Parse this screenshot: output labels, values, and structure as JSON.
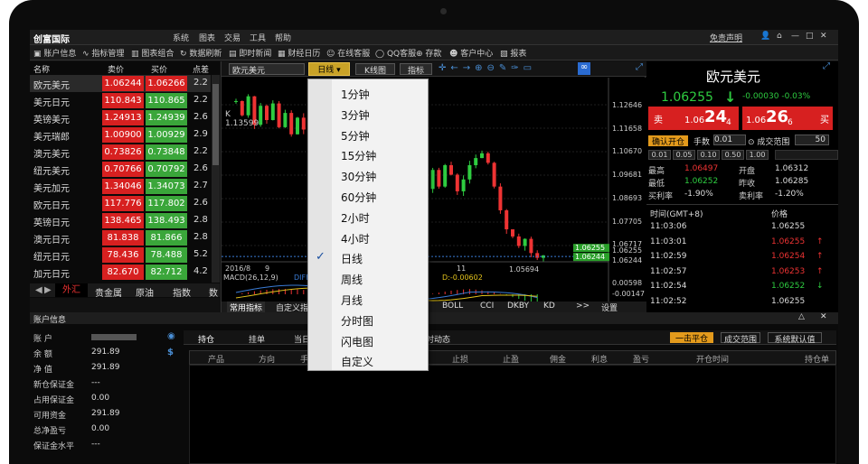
{
  "app": {
    "logo": "创富国际",
    "menus": [
      "系统",
      "图表",
      "交易",
      "工具",
      "帮助"
    ],
    "disclaimer": "免责声明"
  },
  "toolbar": [
    "账户信息",
    "指标管理",
    "图表组合",
    "数据刷新",
    "即时新闻",
    "财经日历",
    "在线客服",
    "QQ客服",
    "存款",
    "客户中心",
    "报表"
  ],
  "watchlist": {
    "headers": [
      "名称",
      "卖价",
      "买价",
      "点差"
    ],
    "rows": [
      {
        "name": "欧元美元",
        "sell": "1.06244",
        "buy": "1.06266",
        "spread": "2.2"
      },
      {
        "name": "美元日元",
        "sell": "110.843",
        "buy": "110.865",
        "spread": "2.2"
      },
      {
        "name": "英镑美元",
        "sell": "1.24913",
        "buy": "1.24939",
        "spread": "2.6"
      },
      {
        "name": "美元瑞郎",
        "sell": "1.00900",
        "buy": "1.00929",
        "spread": "2.9"
      },
      {
        "name": "澳元美元",
        "sell": "0.73826",
        "buy": "0.73848",
        "spread": "2.2"
      },
      {
        "name": "纽元美元",
        "sell": "0.70766",
        "buy": "0.70792",
        "spread": "2.6"
      },
      {
        "name": "美元加元",
        "sell": "1.34046",
        "buy": "1.34073",
        "spread": "2.7"
      },
      {
        "name": "欧元日元",
        "sell": "117.776",
        "buy": "117.802",
        "spread": "2.6"
      },
      {
        "name": "英镑日元",
        "sell": "138.465",
        "buy": "138.493",
        "spread": "2.8"
      },
      {
        "name": "澳元日元",
        "sell": "81.838",
        "buy": "81.866",
        "spread": "2.8"
      },
      {
        "name": "纽元日元",
        "sell": "78.436",
        "buy": "78.488",
        "spread": "5.2"
      },
      {
        "name": "加元日元",
        "sell": "82.670",
        "buy": "82.712",
        "spread": "4.2"
      }
    ],
    "tabs": [
      "外汇",
      "贵金属",
      "原油",
      "指数",
      "数"
    ]
  },
  "chart": {
    "symbol": "欧元美元",
    "period": "日线",
    "ktype": "K线图",
    "indicator": "指标",
    "k_label": "K",
    "k_value": "1.13599",
    "prices": [
      "1.12646",
      "1.11658",
      "1.10670",
      "1.09681",
      "1.08693",
      "1.07705",
      "1.06717",
      "1.06255",
      "1.06244"
    ],
    "tag1": "1.06255",
    "tag2": "1.06244",
    "low_label": "1.05694",
    "dates": [
      "2016/8",
      "9",
      "11"
    ],
    "macd_label": "MACD(26,12,9)",
    "diff_label": "DIFF",
    "macd_value": "D:-0.00602",
    "macd_prices": [
      "0.00598",
      "-0.00147",
      "-0.01148"
    ],
    "bottom_tabs": [
      "常用指标",
      "自定义指标",
      "BOLL",
      "CCI",
      "DKBY",
      "KD",
      ">>",
      "设置"
    ]
  },
  "dropdown": {
    "items": [
      "1分钟",
      "3分钟",
      "5分钟",
      "15分钟",
      "30分钟",
      "60分钟",
      "2小时",
      "4小时",
      "日线",
      "周线",
      "月线",
      "分时图",
      "闪电图",
      "自定义"
    ],
    "checked_index": 8
  },
  "right": {
    "symbol": "欧元美元",
    "price": "1.06255",
    "arrow": "↓",
    "change": "-0.00030",
    "change_pct": "-0.03%",
    "sell_label": "卖",
    "sell_main": "1.06",
    "sell_big": "24",
    "sell_small": "4",
    "buy_big": "26",
    "buy_small": "6",
    "buy_label": "买",
    "buy_main": "1.06",
    "confirm": "确认开仓",
    "hands_label": "手数",
    "hands": "0.01",
    "range_label": "成交范围",
    "range": "50",
    "quick": [
      "0.01",
      "0.05",
      "0.10",
      "0.50",
      "1.00"
    ],
    "stats": [
      [
        "最高",
        "1.06497",
        "开盘",
        "1.06312"
      ],
      [
        "最低",
        "1.06252",
        "昨收",
        "1.06285"
      ],
      [
        "买利率",
        "-1.90%",
        "卖利率",
        "-1.20%"
      ]
    ],
    "tick_headers": [
      "时间(GMT+8)",
      "价格"
    ],
    "ticks": [
      [
        "11:03:06",
        "1.06255",
        ""
      ],
      [
        "11:03:01",
        "1.06255",
        "↑"
      ],
      [
        "11:02:59",
        "1.06254",
        "↑"
      ],
      [
        "11:02:57",
        "1.06253",
        "↑"
      ],
      [
        "11:02:54",
        "1.06252",
        "↓"
      ],
      [
        "11:02:52",
        "1.06255",
        ""
      ]
    ]
  },
  "bottom": {
    "title": "账户信息",
    "account": [
      [
        "账 户",
        ""
      ],
      [
        "余 额",
        "291.89"
      ],
      [
        "净 值",
        "291.89"
      ],
      [
        "新仓保证金",
        "---"
      ],
      [
        "占用保证金",
        "0.00"
      ],
      [
        "可用资金",
        "291.89"
      ],
      [
        "总净盈亏",
        "0.00"
      ],
      [
        "保证金水平",
        "---"
      ]
    ],
    "tabs": [
      "持仓",
      "挂单",
      "当日",
      "时动态"
    ],
    "buttons": [
      "一击平仓",
      "成交范围",
      "系统默认值"
    ],
    "columns": [
      "产品",
      "方向",
      "手",
      "止损",
      "止盈",
      "佣金",
      "利息",
      "盈亏",
      "开仓时间",
      "持仓单号"
    ]
  }
}
